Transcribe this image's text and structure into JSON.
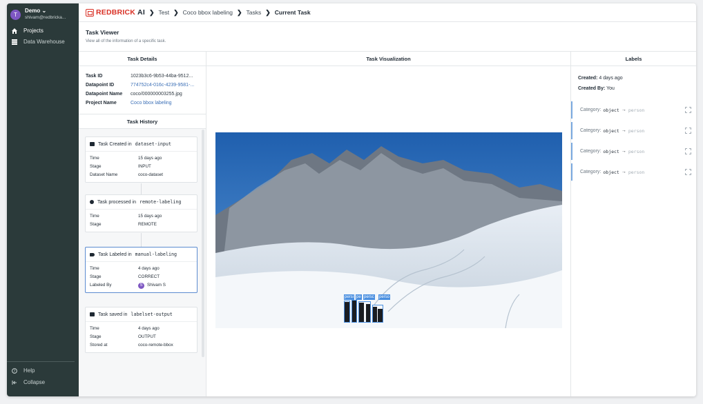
{
  "workspace": {
    "initial": "T",
    "name": "Demo ⌄",
    "email": "shivam@redbricka..."
  },
  "sidebar": {
    "items": [
      {
        "label": "Projects",
        "icon": "home-icon"
      },
      {
        "label": "Data Warehouse",
        "icon": "database-icon"
      }
    ],
    "footer": [
      {
        "label": "Help",
        "icon": "help-icon"
      },
      {
        "label": "Collapse",
        "icon": "collapse-icon"
      }
    ]
  },
  "header": {
    "logo_red": "REDBRICK",
    "logo_dark": "AI",
    "breadcrumbs": [
      "Test",
      "Coco bbox labeling",
      "Tasks",
      "Current Task"
    ]
  },
  "viewer": {
    "title": "Task Viewer",
    "subtitle": "View all of the information of a specific task."
  },
  "task_details": {
    "heading": "Task Details",
    "rows": [
      {
        "key": "Task ID",
        "value": "1023b3c6-9b53-44ba-9512..."
      },
      {
        "key": "Datapoint ID",
        "value": "774752c4-016c-4239-9581-..."
      },
      {
        "key": "Datapoint Name",
        "value": "coco/000000003255.jpg"
      },
      {
        "key": "Project Name",
        "value": "Coco bbox labeling"
      }
    ]
  },
  "history": {
    "heading": "Task History",
    "cards": [
      {
        "title": "Task Created in",
        "code": "dataset-input",
        "rows": [
          [
            "Time",
            "15 days ago"
          ],
          [
            "Stage",
            "INPUT"
          ],
          [
            "Dataset Name",
            "coco-dataset"
          ]
        ]
      },
      {
        "title": "Task processed in",
        "code": "remote-labeling",
        "rows": [
          [
            "Time",
            "15 days ago"
          ],
          [
            "Stage",
            "REMOTE"
          ]
        ]
      },
      {
        "title": "Task Labeled in",
        "code": "manual-labeling",
        "rows": [
          [
            "Time",
            "4 days ago"
          ],
          [
            "Stage",
            "CORRECT"
          ],
          [
            "Labeled By",
            "Shivam S"
          ]
        ],
        "avatar": "S"
      },
      {
        "title": "Task saved in",
        "code": "labelset-output",
        "rows": [
          [
            "Time",
            "4 days ago"
          ],
          [
            "Stage",
            "OUTPUT"
          ],
          [
            "Stored at",
            "coco-remote-bbox"
          ]
        ]
      }
    ]
  },
  "visualization": {
    "heading": "Task Visualization",
    "box_labels": [
      "persi",
      "pe",
      "persc",
      "perso"
    ]
  },
  "labels": {
    "heading": "Labels",
    "created_key": "Created:",
    "created_val": "4 days ago",
    "created_by_key": "Created By:",
    "created_by_val": "You",
    "items": [
      {
        "prefix": "Category:",
        "cls": "object",
        "arrow": "→",
        "value": "person"
      },
      {
        "prefix": "Category:",
        "cls": "object",
        "arrow": "→",
        "value": "person"
      },
      {
        "prefix": "Category:",
        "cls": "object",
        "arrow": "→",
        "value": "person"
      },
      {
        "prefix": "Category:",
        "cls": "object",
        "arrow": "→",
        "value": "person"
      }
    ]
  },
  "colors": {
    "sidebar": "#2b3a3a",
    "accent": "#4a8fe0",
    "brand": "#d93025",
    "avatar": "#7e57c2"
  }
}
